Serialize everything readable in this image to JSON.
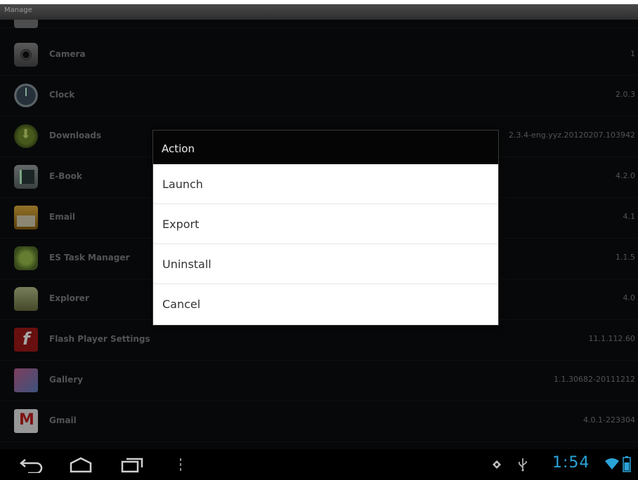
{
  "window": {
    "title": "Manage"
  },
  "apps": [
    {
      "name": "Camera",
      "version": "1",
      "icon": "camera-icon"
    },
    {
      "name": "Clock",
      "version": "2.0.3",
      "icon": "clock-icon"
    },
    {
      "name": "Downloads",
      "version": "2.3.4-eng.yyz.20120207.103942",
      "icon": "download-icon"
    },
    {
      "name": "E-Book",
      "version": "4.2.0",
      "icon": "ebook-icon"
    },
    {
      "name": "Email",
      "version": "4.1",
      "icon": "email-icon"
    },
    {
      "name": "ES Task Manager",
      "version": "1.1.5",
      "icon": "task-manager-icon"
    },
    {
      "name": "Explorer",
      "version": "4.0",
      "icon": "explorer-icon"
    },
    {
      "name": "Flash Player Settings",
      "version": "11.1.112.60",
      "icon": "flash-icon"
    },
    {
      "name": "Gallery",
      "version": "1.1.30682-20111212",
      "icon": "gallery-icon"
    },
    {
      "name": "Gmail",
      "version": "4.0.1-223304",
      "icon": "gmail-icon"
    }
  ],
  "dialog": {
    "title": "Action",
    "options": [
      "Launch",
      "Export",
      "Uninstall",
      "Cancel"
    ]
  },
  "status": {
    "time": "1:54",
    "accent_color": "#2aa3d8"
  }
}
